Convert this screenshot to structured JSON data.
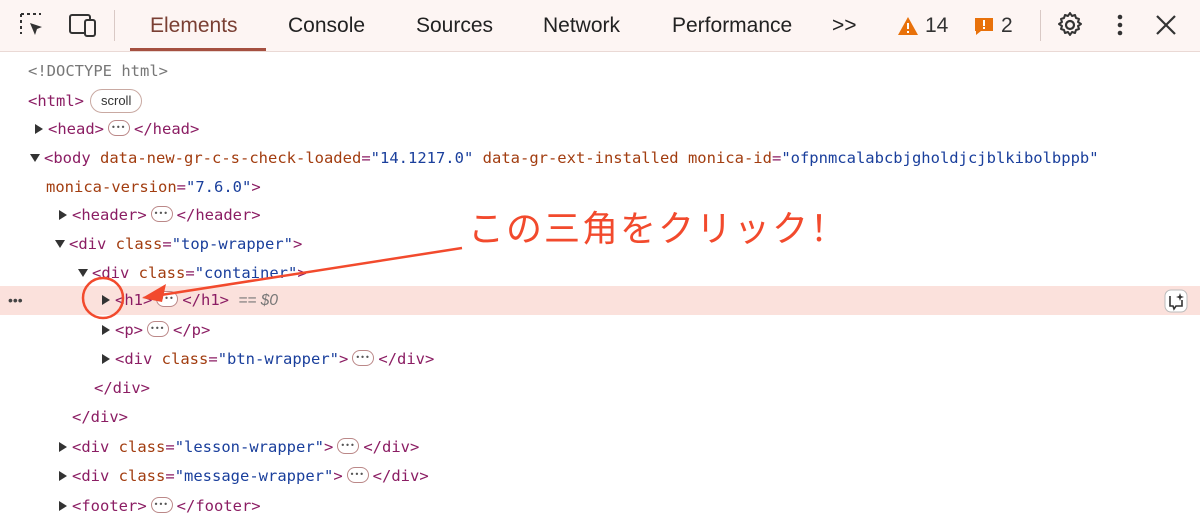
{
  "toolbar": {
    "tabs": [
      "Elements",
      "Console",
      "Sources",
      "Network",
      "Performance"
    ],
    "more_tabs": ">>",
    "warnings_count": "14",
    "errors_count": "2",
    "icons": [
      "inspect-element-icon",
      "device-toolbar-icon",
      "gear-icon",
      "kebab-menu-icon",
      "close-icon"
    ]
  },
  "tree": {
    "doctype": "<!DOCTYPE html>",
    "html_tag": "<html>",
    "scroll_badge": "scroll",
    "head_open": "<head>",
    "head_close": "</head>",
    "body_open": "<body",
    "body_attr1": "data-new-gr-c-s-check-loaded",
    "body_val1": "\"14.1217.0\"",
    "body_attr2": "data-gr-ext-installed",
    "body_attr3": "monica-id",
    "body_val3": "\"ofpnmcalabcbjgholdjcjblkibolbppb\"",
    "body_attr4": "monica-version",
    "body_val4": "\"7.6.0\"",
    "header_open": "<header>",
    "header_close": "</header>",
    "div_open": "<div",
    "class_attr": "class",
    "top_wrapper_val": "\"top-wrapper\"",
    "container_val": "\"container\"",
    "h1_open": "<h1>",
    "h1_close": "</h1>",
    "selected_hint": "== $0",
    "p_open": "<p>",
    "p_close": "</p>",
    "btn_wrapper_val": "\"btn-wrapper\"",
    "div_close": "</div>",
    "lesson_wrapper_val": "\"lesson-wrapper\"",
    "message_wrapper_val": "\"message-wrapper\"",
    "footer_open": "<footer>",
    "footer_close": "</footer>"
  },
  "annotation": {
    "text": "この三角をクリック！",
    "color": "#f24a2d"
  },
  "colors": {
    "tag": "#8b1d63",
    "attribute": "#a23d10",
    "value": "#1a3f9c",
    "selection": "#fbe1dc",
    "toolbar_bg": "#fdf5f3"
  }
}
